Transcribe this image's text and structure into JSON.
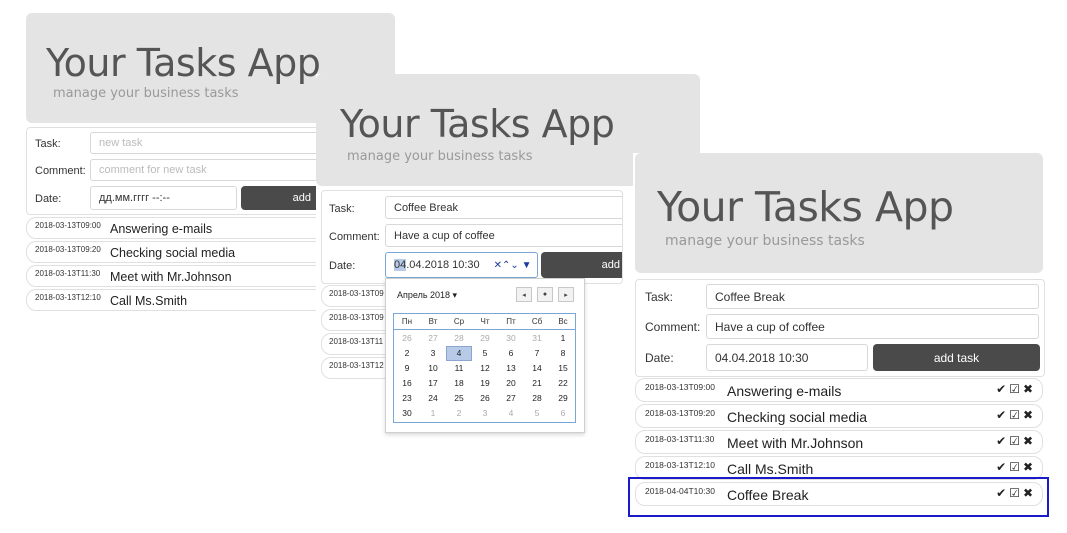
{
  "app": {
    "title": "Your Tasks App",
    "subtitle": "manage your business tasks"
  },
  "form_labels": {
    "task": "Task:",
    "comment": "Comment:",
    "date": "Date:",
    "add_button": "add task",
    "add_button_clipped": "add"
  },
  "panel1": {
    "task_placeholder": "new task",
    "comment_placeholder": "comment for new task",
    "date_placeholder": "дд.мм.гггг --:--",
    "tasks": [
      {
        "timestamp": "2018-03-13T09:00",
        "name": "Answering e-mails"
      },
      {
        "timestamp": "2018-03-13T09:20",
        "name": "Checking social media"
      },
      {
        "timestamp": "2018-03-13T11:30",
        "name": "Meet with Mr.Johnson"
      },
      {
        "timestamp": "2018-03-13T12:10",
        "name": "Call Ms.Smith"
      }
    ]
  },
  "panel2": {
    "task_value": "Coffee Break",
    "comment_value": "Have a cup of coffee",
    "date_day_selected": "04",
    "date_rest": ".04.2018 10:30",
    "date_controls": "✕⌃⌄ ▼",
    "tasks_clipped": [
      "2018-03-13T09",
      "2018-03-13T09",
      "2018-03-13T11",
      "2018-03-13T12"
    ],
    "calendar": {
      "month_label": "Апрель 2018 ▾",
      "prev": "◂",
      "today": "●",
      "next": "▸",
      "weekdays": [
        "Пн",
        "Вт",
        "Ср",
        "Чт",
        "Пт",
        "Сб",
        "Вс"
      ],
      "weeks": [
        [
          "26",
          "27",
          "28",
          "29",
          "30",
          "31",
          "1"
        ],
        [
          "2",
          "3",
          "4",
          "5",
          "6",
          "7",
          "8"
        ],
        [
          "9",
          "10",
          "11",
          "12",
          "13",
          "14",
          "15"
        ],
        [
          "16",
          "17",
          "18",
          "19",
          "20",
          "21",
          "22"
        ],
        [
          "23",
          "24",
          "25",
          "26",
          "27",
          "28",
          "29"
        ],
        [
          "30",
          "1",
          "2",
          "3",
          "4",
          "5",
          "6"
        ]
      ],
      "selected_day": "4"
    }
  },
  "panel3": {
    "task_value": "Coffee Break",
    "comment_value": "Have a cup of coffee",
    "date_value": "04.04.2018 10:30",
    "tasks": [
      {
        "timestamp": "2018-03-13T09:00",
        "name": "Answering e-mails"
      },
      {
        "timestamp": "2018-03-13T09:20",
        "name": "Checking social media"
      },
      {
        "timestamp": "2018-03-13T11:30",
        "name": "Meet with Mr.Johnson"
      },
      {
        "timestamp": "2018-03-13T12:10",
        "name": "Call Ms.Smith"
      },
      {
        "timestamp": "2018-04-04T10:30",
        "name": "Coffee Break"
      }
    ],
    "action_icons": {
      "done": "✔",
      "edit": "☑",
      "delete": "✖"
    }
  },
  "colors": {
    "jumbotron_bg": "#e4e4e4",
    "button_bg": "#4a4a4a",
    "highlight_border": "#1a1ac8",
    "calendar_selected": "#b7cbe8"
  }
}
